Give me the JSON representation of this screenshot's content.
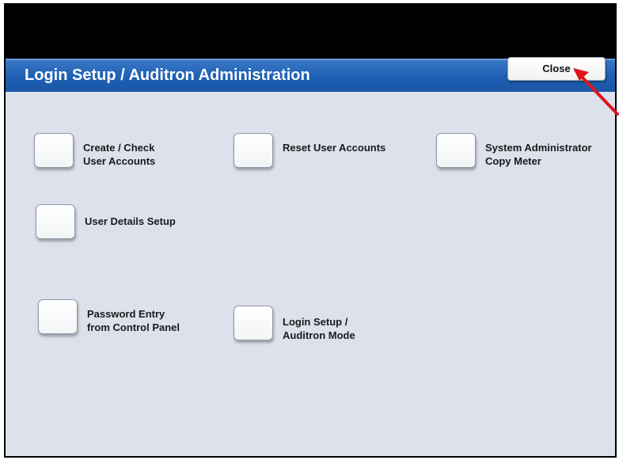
{
  "title_bar": {
    "title": "Login Setup / Auditron Administration",
    "close_label": "Close"
  },
  "options": [
    {
      "id": "create-check-user-accounts",
      "label": "Create / Check\nUser Accounts"
    },
    {
      "id": "reset-user-accounts",
      "label": "Reset User Accounts"
    },
    {
      "id": "system-administrator-copy-meter",
      "label": "System Administrator\nCopy Meter"
    },
    {
      "id": "user-details-setup",
      "label": "User Details Setup"
    },
    {
      "id": "password-entry-from-control-panel",
      "label": "Password Entry\nfrom Control Panel"
    },
    {
      "id": "login-setup-auditron-mode",
      "label": "Login Setup /\nAuditron Mode"
    }
  ],
  "colors": {
    "title_bar_bg": "#1d5fb4",
    "panel_bg": "#dde1ec",
    "annotation_arrow": "#e0141b"
  },
  "icons": {
    "annotation": "red-arrow-pointing-to-close"
  }
}
